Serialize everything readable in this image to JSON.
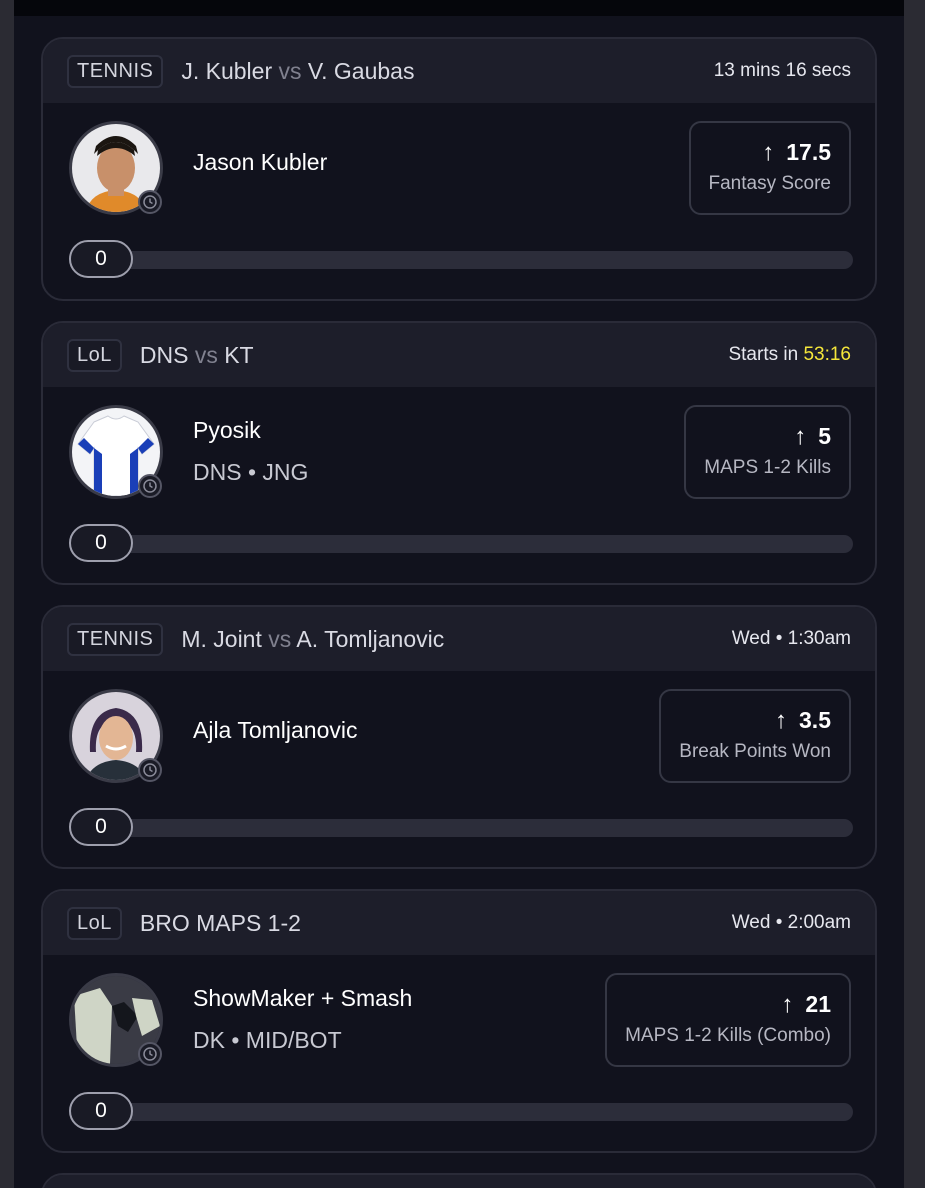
{
  "cards": [
    {
      "sport": "TENNIS",
      "team_a": "J. Kubler",
      "vs": "vs",
      "team_b": "V. Gaubas",
      "time_prefix": "13 mins 16 secs",
      "time_highlight": "",
      "player_name": "Jason Kubler",
      "player_sub": "",
      "proj_value": "17.5",
      "proj_label": "Fantasy Score",
      "progress": "0"
    },
    {
      "sport": "LoL",
      "team_a": "DNS",
      "vs": "vs",
      "team_b": "KT",
      "time_prefix": "Starts in ",
      "time_highlight": "53:16",
      "player_name": "Pyosik",
      "player_sub": "DNS • JNG",
      "proj_value": "5",
      "proj_label": "MAPS 1-2 Kills",
      "progress": "0"
    },
    {
      "sport": "TENNIS",
      "team_a": "M. Joint",
      "vs": "vs",
      "team_b": "A. Tomljanovic",
      "time_prefix": "Wed • 1:30am",
      "time_highlight": "",
      "player_name": "Ajla Tomljanovic",
      "player_sub": "",
      "proj_value": "3.5",
      "proj_label": "Break Points Won",
      "progress": "0"
    },
    {
      "sport": "LoL",
      "team_a": "BRO MAPS 1-2",
      "vs": "",
      "team_b": "",
      "time_prefix": "Wed • 2:00am",
      "time_highlight": "",
      "player_name": "ShowMaker + Smash",
      "player_sub": "DK • MID/BOT",
      "proj_value": "21",
      "proj_label": "MAPS 1-2 Kills (Combo)",
      "progress": "0"
    }
  ],
  "icons": {
    "projection_direction": "arrow-up-icon",
    "avatar_badge": "clock-icon"
  },
  "colors": {
    "background": "#11121d",
    "card_header": "#1d1e2a",
    "countdown_highlight": "#f5e63a"
  }
}
